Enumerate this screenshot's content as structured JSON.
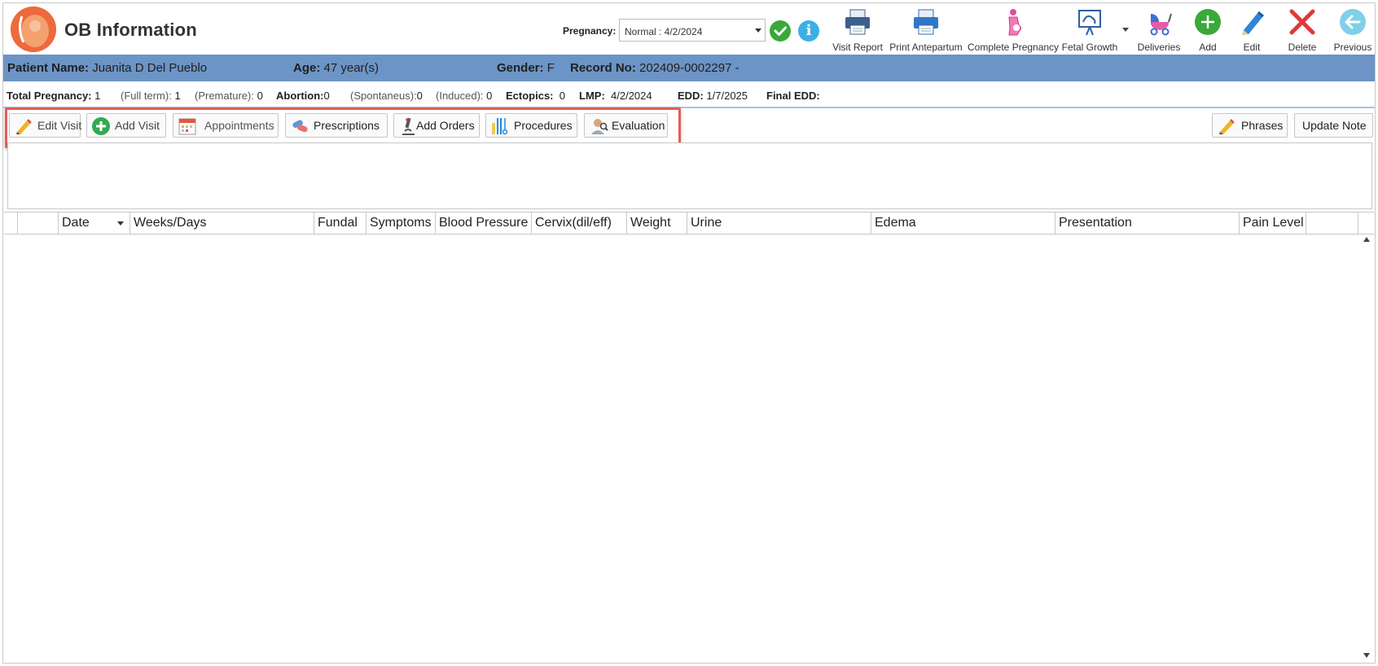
{
  "app": {
    "title": "OB Information",
    "logo_icon": "pregnancy-logo-icon"
  },
  "pregnancy": {
    "label": "Pregnancy:",
    "selected": "Normal : 4/2/2024"
  },
  "toolbar": {
    "visit_report": "Visit Report",
    "print_antepartum": "Print Antepartum",
    "complete_pregnancy": "Complete Pregnancy",
    "fetal_growth": "Fetal Growth",
    "deliveries": "Deliveries",
    "add": "Add",
    "edit": "Edit",
    "delete": "Delete",
    "previous": "Previous"
  },
  "patient": {
    "name_label": "Patient Name:",
    "name": "Juanita D Del Pueblo",
    "age_label": "Age:",
    "age": "47 year(s)",
    "gender_label": "Gender:",
    "gender": "F",
    "record_label": "Record No:",
    "record": "202409-0002297 -"
  },
  "summary": {
    "total_label": "Total Pregnancy:",
    "total": "1",
    "fullterm_label": "(Full term):",
    "fullterm": "1",
    "premature_label": "(Premature):",
    "premature": "0",
    "abortion_label": "Abortion:",
    "abortion": "0",
    "spontaneus_label": "(Spontaneus):",
    "spontaneus": "0",
    "induced_label": "(Induced):",
    "induced": "0",
    "ectopics_label": "Ectopics:",
    "ectopics": "0",
    "lmp_label": "LMP:",
    "lmp": "4/2/2024",
    "edd_label": "EDD:",
    "edd": "1/7/2025",
    "final_edd_label": "Final EDD:",
    "final_edd": ""
  },
  "actions": {
    "edit_visit": "Edit Visit",
    "add_visit": "Add Visit",
    "appointments": "Appointments",
    "prescriptions": "Prescriptions",
    "add_orders": "Add Orders",
    "procedures": "Procedures",
    "evaluation": "Evaluation",
    "phrases": "Phrases",
    "update_note": "Update Note"
  },
  "note": {
    "value": ""
  },
  "grid": {
    "columns": [
      "Date",
      "Weeks/Days",
      "Fundal",
      "Symptoms",
      "Blood Pressure",
      "Cervix(dil/eff)",
      "Weight",
      "Urine",
      "Edema",
      "Presentation",
      "Pain Level"
    ],
    "rows": []
  },
  "colors": {
    "patient_bar": "#6c94c6",
    "highlight": "#e35d57",
    "add_green": "#3aa83a",
    "delete_red": "#e03838",
    "previous_teal": "#3ab8d8"
  }
}
